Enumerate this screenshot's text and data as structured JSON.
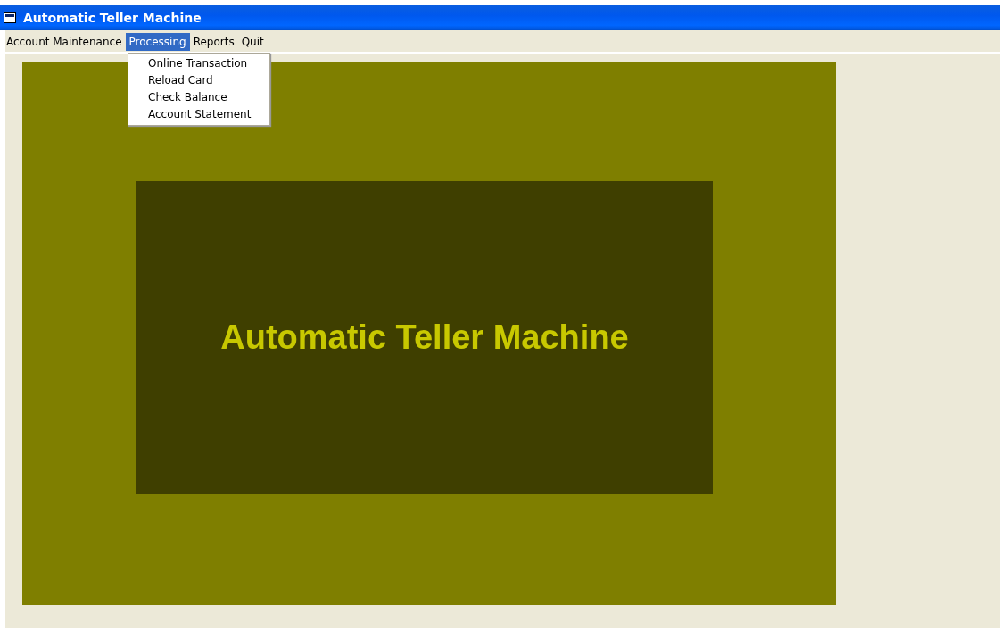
{
  "window": {
    "title": "Automatic Teller Machine"
  },
  "menu": [
    {
      "label": "Account Maintenance",
      "selected": false
    },
    {
      "label": "Processing",
      "selected": true
    },
    {
      "label": "Reports",
      "selected": false
    },
    {
      "label": "Quit",
      "selected": false
    }
  ],
  "dropdown": {
    "items": [
      "Online Transaction",
      "Reload Card",
      "Check Balance",
      "Account Statement"
    ]
  },
  "banner": {
    "title": "Automatic Teller Machine"
  }
}
